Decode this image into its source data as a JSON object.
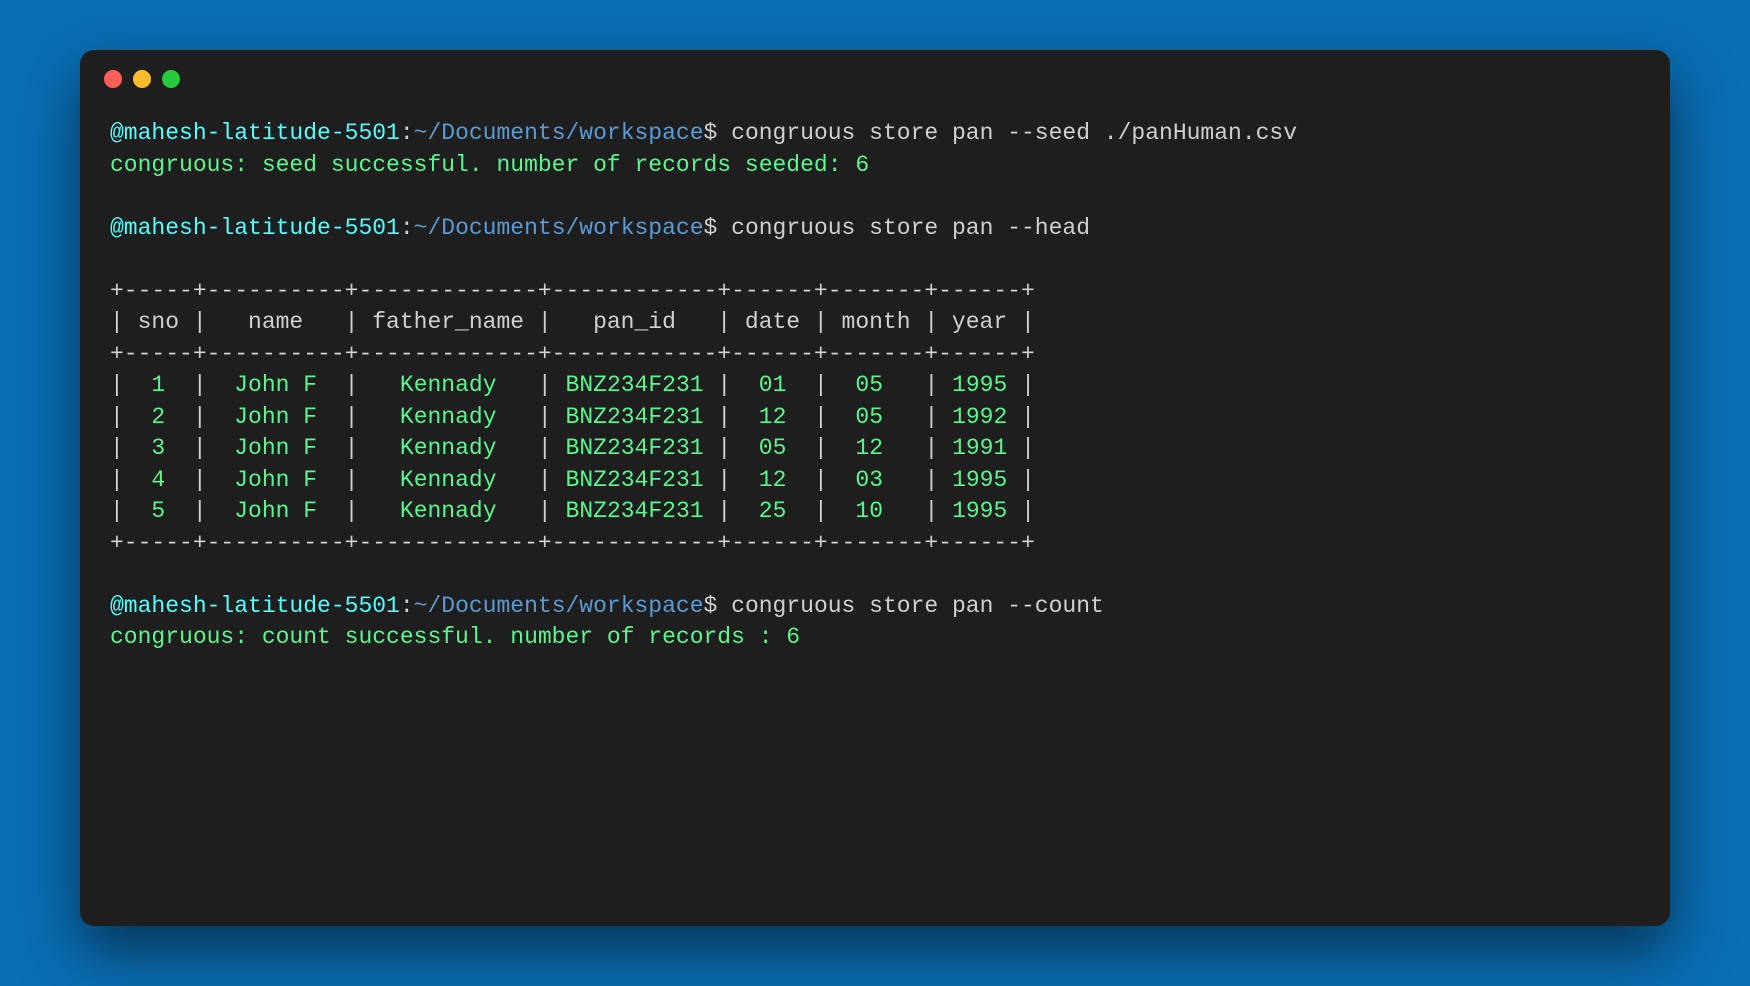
{
  "titlebar": {
    "dots": [
      "red",
      "yellow",
      "green"
    ]
  },
  "prompts": {
    "host": "@mahesh-latitude-5501",
    "sep_host": ":",
    "path": "~/Documents/workspace",
    "dollar": "$"
  },
  "lines": [
    {
      "type": "prompt",
      "cmd": "congruous store pan --seed ./panHuman.csv"
    },
    {
      "type": "output",
      "text": "congruous: seed successful. number of records seeded: 6"
    },
    {
      "type": "blank"
    },
    {
      "type": "prompt",
      "cmd": "congruous store pan --head"
    },
    {
      "type": "blank"
    },
    {
      "type": "tborder",
      "text": "+-----+----------+-------------+------------+------+-------+------+"
    },
    {
      "type": "thead",
      "text": "| sno |   name   | father_name |   pan_id   | date | month | year |"
    },
    {
      "type": "tborder",
      "text": "+-----+----------+-------------+------------+------+-------+------+"
    },
    {
      "type": "trow",
      "cells": [
        "1",
        "John F",
        "Kennady",
        "BNZ234F231",
        "01",
        "05",
        "1995"
      ]
    },
    {
      "type": "trow",
      "cells": [
        "2",
        "John F",
        "Kennady",
        "BNZ234F231",
        "12",
        "05",
        "1992"
      ]
    },
    {
      "type": "trow",
      "cells": [
        "3",
        "John F",
        "Kennady",
        "BNZ234F231",
        "05",
        "12",
        "1991"
      ]
    },
    {
      "type": "trow",
      "cells": [
        "4",
        "John F",
        "Kennady",
        "BNZ234F231",
        "12",
        "03",
        "1995"
      ]
    },
    {
      "type": "trow",
      "cells": [
        "5",
        "John F",
        "Kennady",
        "BNZ234F231",
        "25",
        "10",
        "1995"
      ]
    },
    {
      "type": "tborder",
      "text": "+-----+----------+-------------+------------+------+-------+------+"
    },
    {
      "type": "blank"
    },
    {
      "type": "prompt",
      "cmd": "congruous store pan --count"
    },
    {
      "type": "output",
      "text": "congruous: count successful. number of records : 6"
    }
  ],
  "table_widths": [
    5,
    10,
    13,
    12,
    6,
    7,
    6
  ]
}
